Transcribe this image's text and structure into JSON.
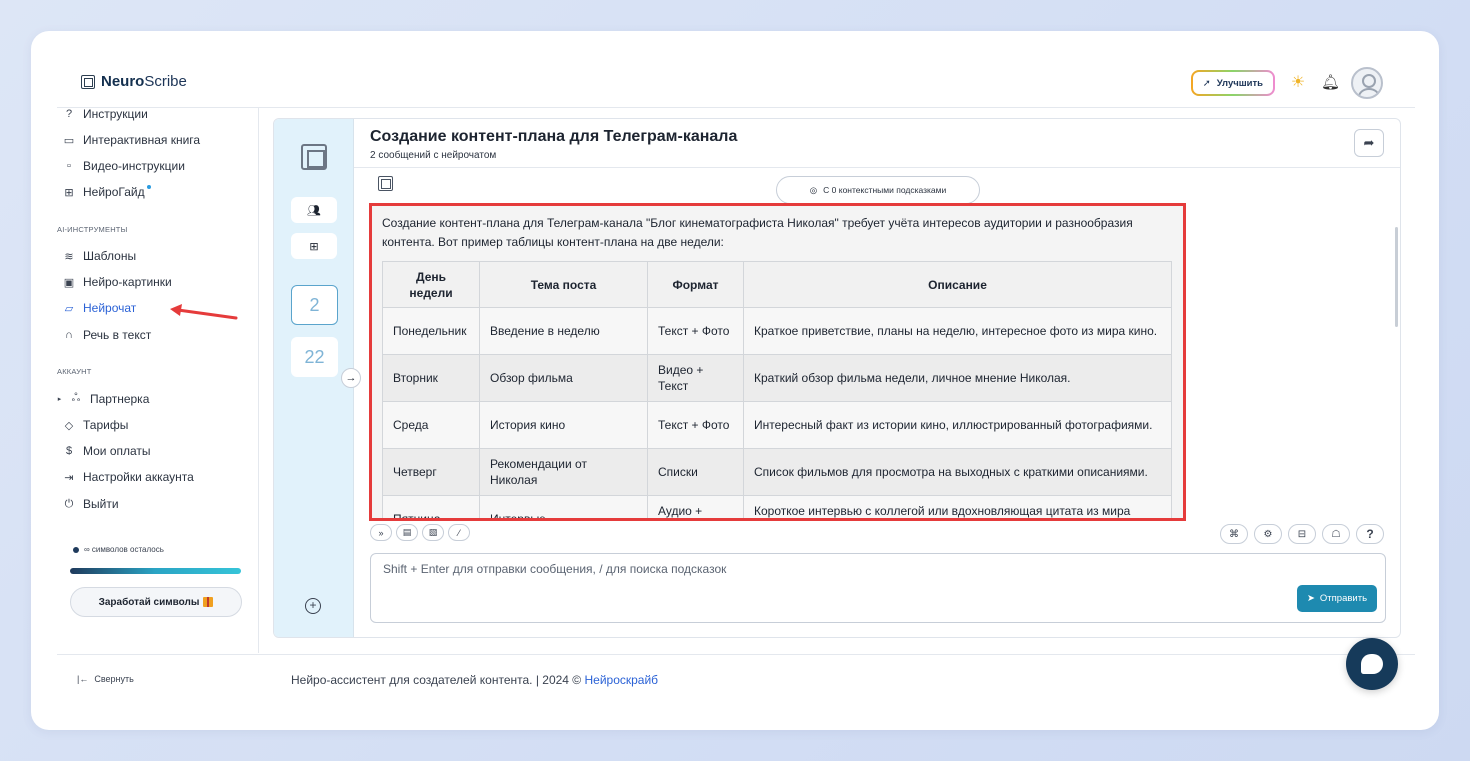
{
  "header": {
    "logo_bold": "Neuro",
    "logo_rest": "Scribe",
    "upgrade_label": "Улучшить"
  },
  "sidebar": {
    "items_top": [
      {
        "label": "Инструкции",
        "icon": "question-circle-icon"
      },
      {
        "label": "Интерактивная книга",
        "icon": "book-icon"
      },
      {
        "label": "Видео-инструкции",
        "icon": "video-icon"
      },
      {
        "label": "НейроГайд",
        "icon": "guide-icon"
      }
    ],
    "section_ai": "AI-ИНСТРУМЕНТЫ",
    "items_ai": [
      {
        "label": "Шаблоны",
        "icon": "layers-icon"
      },
      {
        "label": "Нейро-картинки",
        "icon": "image-icon"
      },
      {
        "label": "Нейрочат",
        "icon": "chat-icon"
      },
      {
        "label": "Речь в текст",
        "icon": "headphones-icon"
      }
    ],
    "section_account": "АККАУНТ",
    "items_account": [
      {
        "label": "Партнерка",
        "icon": "users-icon"
      },
      {
        "label": "Тарифы",
        "icon": "tag-icon"
      },
      {
        "label": "Мои оплаты",
        "icon": "dollar-icon"
      },
      {
        "label": "Настройки аккаунта",
        "icon": "login-icon"
      },
      {
        "label": "Выйти",
        "icon": "power-icon"
      }
    ],
    "symbols_left": "∞ символов осталось",
    "earn_label": "Заработай символы",
    "collapse_label": "Свернуть"
  },
  "chat": {
    "title": "Создание контент-плана для Телеграм-канала",
    "subtitle": "2 сообщений с нейрочатом",
    "rail_numbers": [
      "2",
      "22"
    ],
    "hints_label": "С 0 контекстными подсказками",
    "intro": "Создание контент-плана для Телеграм-канала \"Блог кинематографиста Николая\" требует учёта интересов аудитории и разнообразия контента. Вот пример таблицы контент-плана на две недели:",
    "table": {
      "headers": [
        "День недели",
        "Тема поста",
        "Формат",
        "Описание"
      ],
      "rows": [
        [
          "Понедельник",
          "Введение в неделю",
          "Текст + Фото",
          "Краткое приветствие, планы на неделю, интересное фото из мира кино."
        ],
        [
          "Вторник",
          "Обзор фильма",
          "Видео + Текст",
          "Краткий обзор фильма недели, личное мнение Николая."
        ],
        [
          "Среда",
          "История кино",
          "Текст + Фото",
          "Интересный факт из истории кино, иллюстрированный фотографиями."
        ],
        [
          "Четверг",
          "Рекомендации от Николая",
          "Списки",
          "Список фильмов для просмотра на выходных с краткими описаниями."
        ],
        [
          "Пятница",
          "Интервью",
          "Аудио + Текст",
          "Короткое интервью с коллегой или вдохновляющая цитата из мира кино."
        ]
      ]
    },
    "input_placeholder": "Shift + Enter для отправки сообщения, / для поиска подсказок",
    "send_label": "Отправить"
  },
  "footer": {
    "text": "Нейро-ассистент для создателей контента.  | 2024 © ",
    "link": "Нейроскрайб"
  }
}
